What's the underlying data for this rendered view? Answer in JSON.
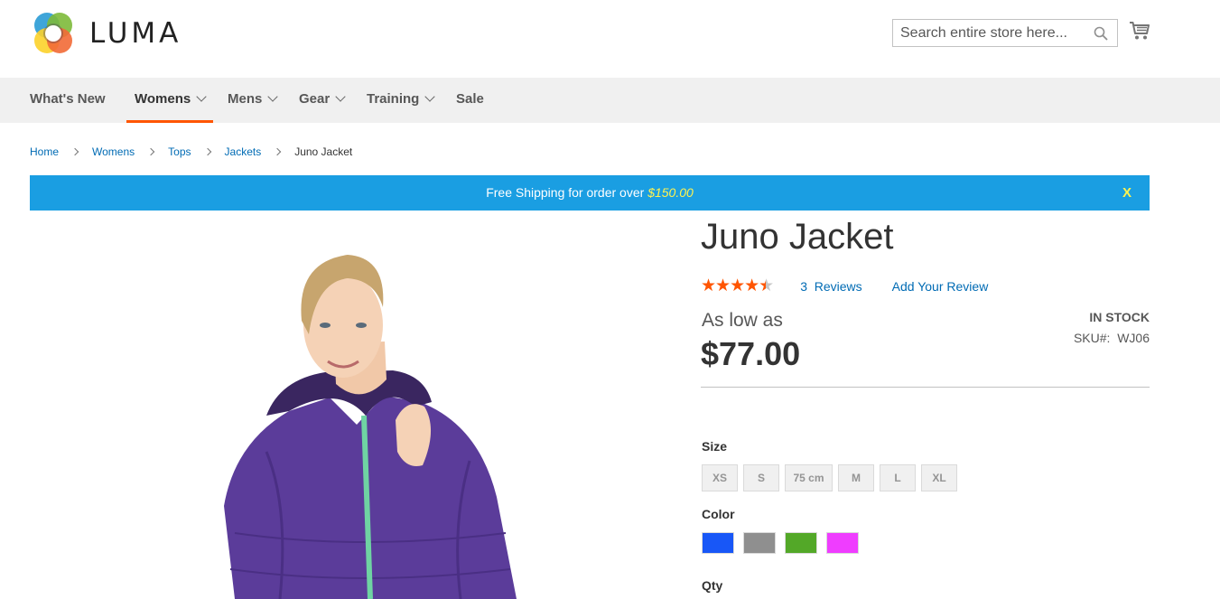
{
  "brand": {
    "name": "LUMA"
  },
  "search": {
    "placeholder": "Search entire store here..."
  },
  "nav": {
    "items": [
      {
        "label": "What's New"
      },
      {
        "label": "Womens"
      },
      {
        "label": "Mens"
      },
      {
        "label": "Gear"
      },
      {
        "label": "Training"
      },
      {
        "label": "Sale"
      }
    ]
  },
  "breadcrumb": {
    "items": [
      "Home",
      "Womens",
      "Tops",
      "Jackets"
    ],
    "current": "Juno Jacket"
  },
  "banner": {
    "text": "Free Shipping for order over",
    "amount": "$150.00",
    "close": "X"
  },
  "product": {
    "title": "Juno Jacket",
    "rating_stars": 4.5,
    "reviews_count": "3",
    "reviews_label": "Reviews",
    "add_review": "Add Your Review",
    "as_low_as": "As low as",
    "price": "$77.00",
    "stock": "IN STOCK",
    "sku_label": "SKU#:",
    "sku": "WJ06",
    "size_label": "Size",
    "sizes": [
      "XS",
      "S",
      "75 cm",
      "M",
      "L",
      "XL"
    ],
    "color_label": "Color",
    "colors": [
      "#1857f7",
      "#8f8f8f",
      "#53a828",
      "#ef3dff"
    ],
    "qty_label": "Qty"
  },
  "colors": {
    "accent": "#ff5501",
    "link": "#006bb4",
    "banner": "#1a9ee2",
    "banner_highlight": "#fff350"
  }
}
